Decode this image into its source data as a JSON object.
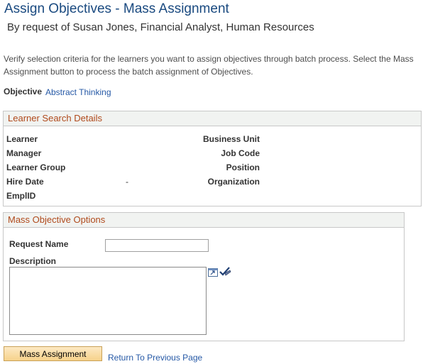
{
  "header": {
    "title": "Assign Objectives - Mass Assignment",
    "subtitle": "By request of Susan Jones, Financial Analyst, Human Resources"
  },
  "instructions": "Verify selection criteria for the learners you want to assign objectives through batch process. Select the Mass Assignment button to process the batch assignment of Objectives.",
  "objective": {
    "label": "Objective",
    "value": "Abstract Thinking"
  },
  "learner_search": {
    "title": "Learner Search Details",
    "left_fields": {
      "learner": "Learner",
      "manager": "Manager",
      "learner_group": "Learner Group",
      "hire_date": "Hire Date",
      "emplid": "EmplID"
    },
    "hire_date_value": "-",
    "right_fields": {
      "business_unit": "Business Unit",
      "job_code": "Job Code",
      "position": "Position",
      "organization": "Organization"
    }
  },
  "mass_options": {
    "title": "Mass Objective Options",
    "request_name_label": "Request Name",
    "request_name_value": "",
    "description_label": "Description",
    "description_value": ""
  },
  "icons": {
    "expand": "expand-textarea-icon",
    "spellcheck": "spellcheck-icon"
  },
  "actions": {
    "mass_assignment": "Mass Assignment",
    "return_link": "Return To Previous Page"
  }
}
